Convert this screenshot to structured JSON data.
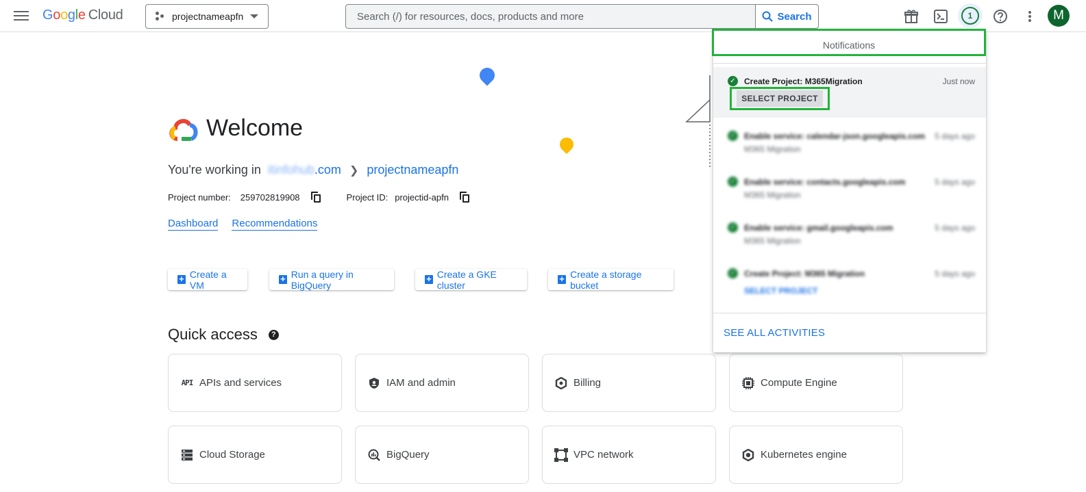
{
  "header": {
    "brand": {
      "letters": [
        "G",
        "o",
        "o",
        "g",
        "l",
        "e"
      ],
      "cloud": "Cloud"
    },
    "project_selector": "projectnameapfn",
    "search_placeholder": "Search (/) for resources, docs, products and more",
    "search_button": "Search",
    "notifications_count": "1",
    "avatar_letter": "M",
    "icons": [
      "menu-icon",
      "gift-icon",
      "cloud-shell-icon",
      "notifications-icon",
      "help-icon",
      "more-vert-icon"
    ]
  },
  "welcome": {
    "title": "Welcome",
    "working_in": "You're working in",
    "org_blurred": "itinfohub",
    "org_suffix": ".com",
    "project": "projectnameapfn",
    "project_number_label": "Project number:",
    "project_number": "259702819908",
    "project_id_label": "Project ID:",
    "project_id": "projectid-apfn",
    "links": [
      "Dashboard",
      "Recommendations"
    ]
  },
  "actions": [
    "Create a VM",
    "Run a query in BigQuery",
    "Create a GKE cluster",
    "Create a storage bucket"
  ],
  "quick_access": {
    "title": "Quick access",
    "cards": [
      {
        "label": "APIs and services",
        "icon": "api-icon"
      },
      {
        "label": "IAM and admin",
        "icon": "shield-icon"
      },
      {
        "label": "Billing",
        "icon": "billing-icon"
      },
      {
        "label": "Compute Engine",
        "icon": "chip-icon"
      },
      {
        "label": "Cloud Storage",
        "icon": "storage-icon"
      },
      {
        "label": "BigQuery",
        "icon": "bigquery-icon"
      },
      {
        "label": "VPC network",
        "icon": "network-icon"
      },
      {
        "label": "Kubernetes engine",
        "icon": "kubernetes-icon"
      }
    ]
  },
  "notifications": {
    "header": "Notifications",
    "items": [
      {
        "title": "Create Project: M365Migration",
        "time": "Just now",
        "action": "SELECT PROJECT"
      },
      {
        "title": "Enable service: calendar-json.googleapis.com",
        "sub": "M365 Migration",
        "time": "5 days ago"
      },
      {
        "title": "Enable service: contacts.googleapis.com",
        "sub": "M365 Migration",
        "time": "5 days ago"
      },
      {
        "title": "Enable service: gmail.googleapis.com",
        "sub": "M365 Migration",
        "time": "5 days ago"
      },
      {
        "title": "Create Project: M365 Migration",
        "time": "5 days ago",
        "action": "SELECT PROJECT"
      }
    ],
    "see_all": "SEE ALL ACTIVITIES"
  },
  "colors": {
    "accent": "#1a73e8",
    "success": "#188038",
    "highlight": "#22b33a"
  }
}
